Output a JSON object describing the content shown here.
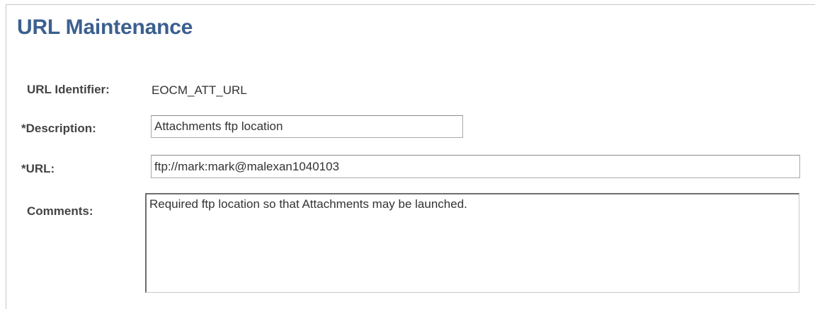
{
  "page": {
    "title": "URL Maintenance"
  },
  "form": {
    "url_identifier": {
      "label": "URL Identifier:",
      "value": "EOCM_ATT_URL"
    },
    "description": {
      "label": "*Description:",
      "value": "Attachments ftp location"
    },
    "url": {
      "label": "*URL:",
      "value": "ftp://mark:mark@malexan1040103"
    },
    "comments": {
      "label": "Comments:",
      "value": "Required ftp location so that Attachments may be launched."
    }
  },
  "colors": {
    "title": "#3b5f8f",
    "label": "#444444",
    "input_border": "#a9a9a9",
    "frame": "#c8c8c8"
  }
}
